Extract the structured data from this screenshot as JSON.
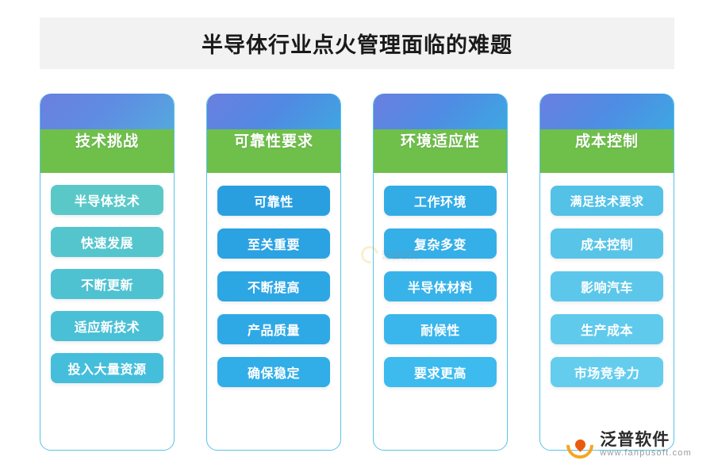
{
  "title": "半导体行业点火管理面临的难题",
  "watermark": {
    "text": "泛普软件"
  },
  "brand": {
    "name": "泛普软件",
    "url": "www.fanpusoft.com"
  },
  "columns": [
    {
      "header": "技术挑战",
      "head_gradient_from": "#6b7fe0",
      "head_gradient_to": "#56c3d8",
      "header_band": "#6fc04b",
      "pill_color": "#5bc8c8",
      "items": [
        "半导体技术",
        "快速发展",
        "不断更新",
        "适应新技术",
        "投入大量资源"
      ]
    },
    {
      "header": "可靠性要求",
      "head_gradient_from": "#6b7fe0",
      "head_gradient_to": "#3ab6de",
      "header_band": "#6fc04b",
      "pill_color": "#2a9fe0",
      "items": [
        "可靠性",
        "至关重要",
        "不断提高",
        "产品质量",
        "确保稳定"
      ]
    },
    {
      "header": "环境适应性",
      "head_gradient_from": "#6b7fe0",
      "head_gradient_to": "#3ab6de",
      "header_band": "#6fc04b",
      "pill_color": "#39b4e8",
      "items": [
        "工作环境",
        "复杂多变",
        "半导体材料",
        "耐候性",
        "要求更高"
      ]
    },
    {
      "header": "成本控制",
      "head_gradient_from": "#6b7fe0",
      "head_gradient_to": "#3ab6de",
      "header_band": "#6fc04b",
      "pill_color": "#62c7ea",
      "items": [
        "满足技术要求",
        "成本控制",
        "影响汽车",
        "生产成本",
        "市场竞争力"
      ]
    }
  ]
}
